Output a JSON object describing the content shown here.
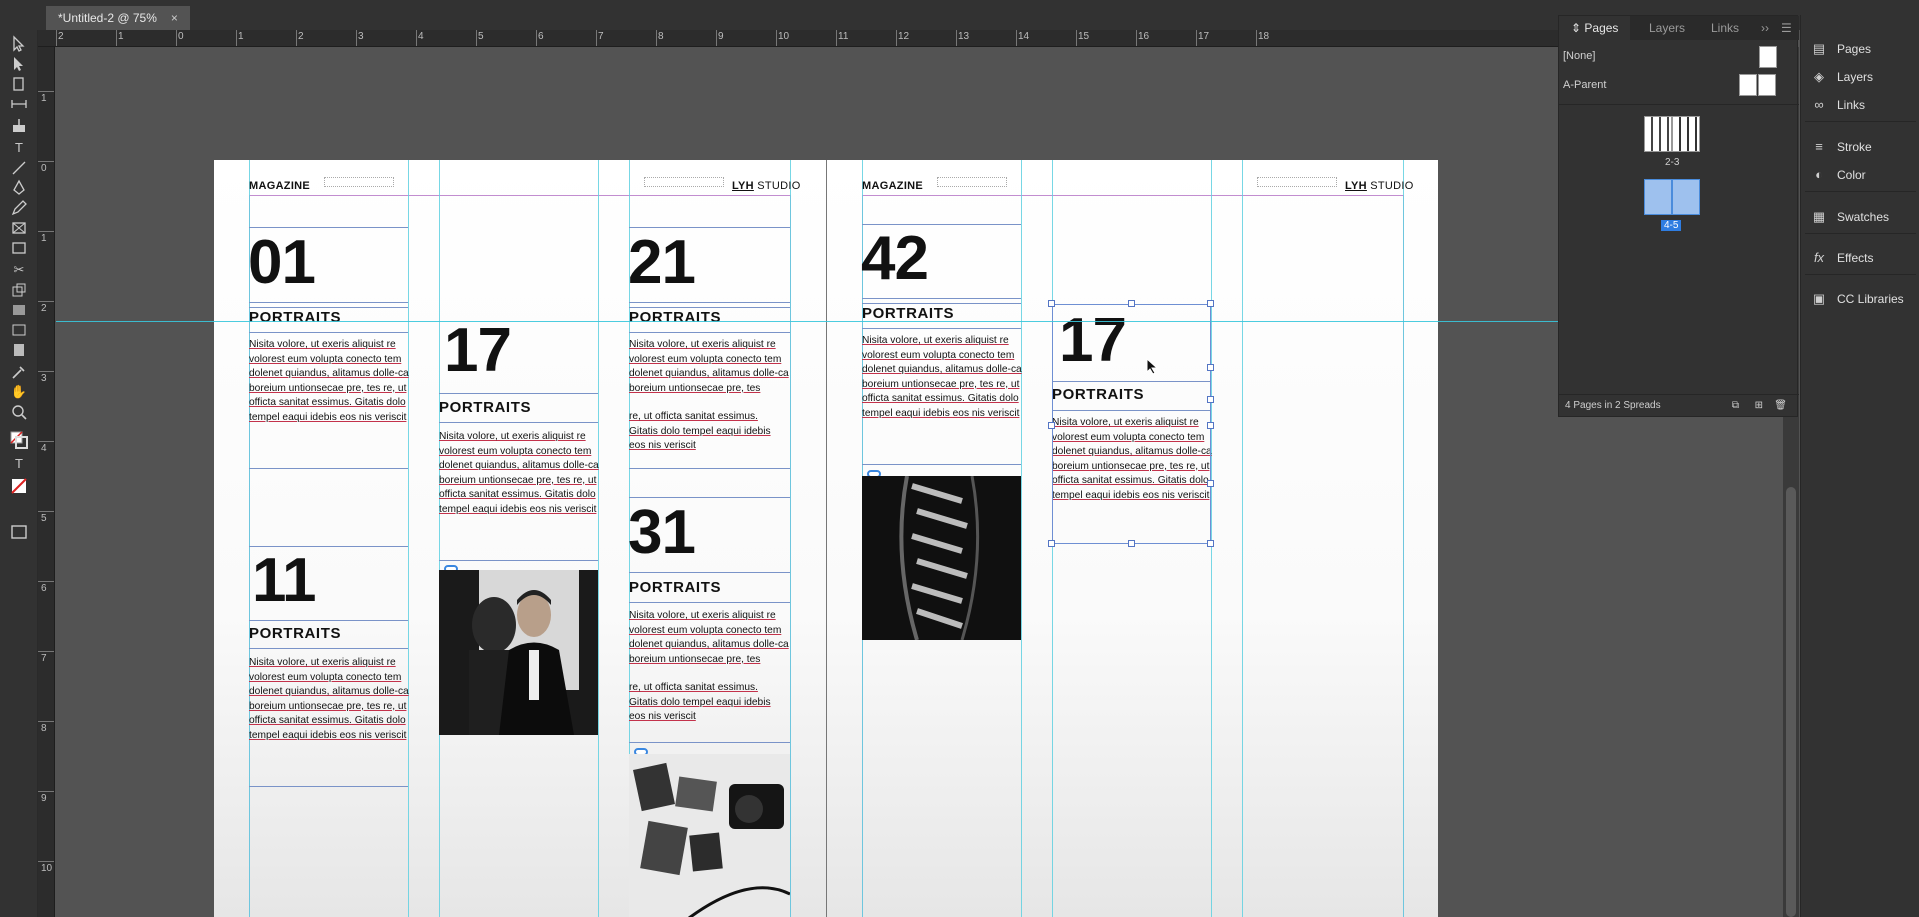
{
  "document_tab": {
    "title": "*Untitled-2 @ 75%",
    "close": "×"
  },
  "ruler": {
    "horizontal": [
      "2",
      "1",
      "0",
      "1",
      "2",
      "3",
      "4",
      "5",
      "6",
      "7",
      "8",
      "9",
      "10",
      "11",
      "12",
      "13",
      "14",
      "15",
      "16",
      "17",
      "18"
    ],
    "vertical": [
      "1",
      "0",
      "1",
      "2",
      "3",
      "4",
      "5",
      "6",
      "7",
      "8",
      "9",
      "10"
    ]
  },
  "spread": {
    "left_page": {
      "header_left": "MAGAZINE",
      "header_right_bold": "LYH",
      "header_right": " STUDIO",
      "blocks": [
        {
          "num": "01",
          "title": "PORTRAITS"
        },
        {
          "num": "11",
          "title": "PORTRAITS"
        },
        {
          "num": "17",
          "title": "PORTRAITS"
        },
        {
          "num": "21",
          "title": "PORTRAITS"
        },
        {
          "num": "31",
          "title": "PORTRAITS"
        }
      ]
    },
    "right_page": {
      "header_left": "MAGAZINE",
      "header_right_bold": "LYH",
      "header_right": " STUDIO",
      "blocks": [
        {
          "num": "42",
          "title": "PORTRAITS"
        },
        {
          "num": "17",
          "title": "PORTRAITS"
        }
      ]
    },
    "body_text": "Nisita volore, ut exeris aliquist re volorest eum volupta conecto tem dolenet quiandus, alitamus dolle-ca boreium untionsecae pre, tes re, ut officta sanitat essimus. Gitatis dolo tempel eaqui idebis eos nis veriscit",
    "body_text_split_a": "Nisita volore, ut exeris aliquist re volorest eum volupta conecto tem dolenet quiandus, alitamus dolle-ca boreium untionsecae pre, tes",
    "body_text_split_b": "re, ut officta sanitat essimus. Gitatis dolo tempel eaqui idebis eos nis veriscit"
  },
  "pages_panel": {
    "tabs": [
      "Pages",
      "Layers",
      "Links"
    ],
    "none_label": "[None]",
    "parent_label": "A-Parent",
    "spread1_label": "2-3",
    "spread2_label": "4-5",
    "footer": "4 Pages in 2 Spreads"
  },
  "dock": {
    "items": [
      "Pages",
      "Layers",
      "Links",
      "Stroke",
      "Color",
      "Swatches",
      "Effects",
      "CC Libraries"
    ],
    "icons": [
      "pages-icon",
      "layers-icon",
      "links-icon",
      "stroke-icon",
      "color-icon",
      "swatches-icon",
      "effects-icon",
      "cc-libraries-icon"
    ]
  },
  "colors": {
    "guide": "#39c6dc",
    "margin": "#c28dd0",
    "selection": "#5475c4",
    "ui_bg": "#323232",
    "pasteboard": "#535353"
  }
}
